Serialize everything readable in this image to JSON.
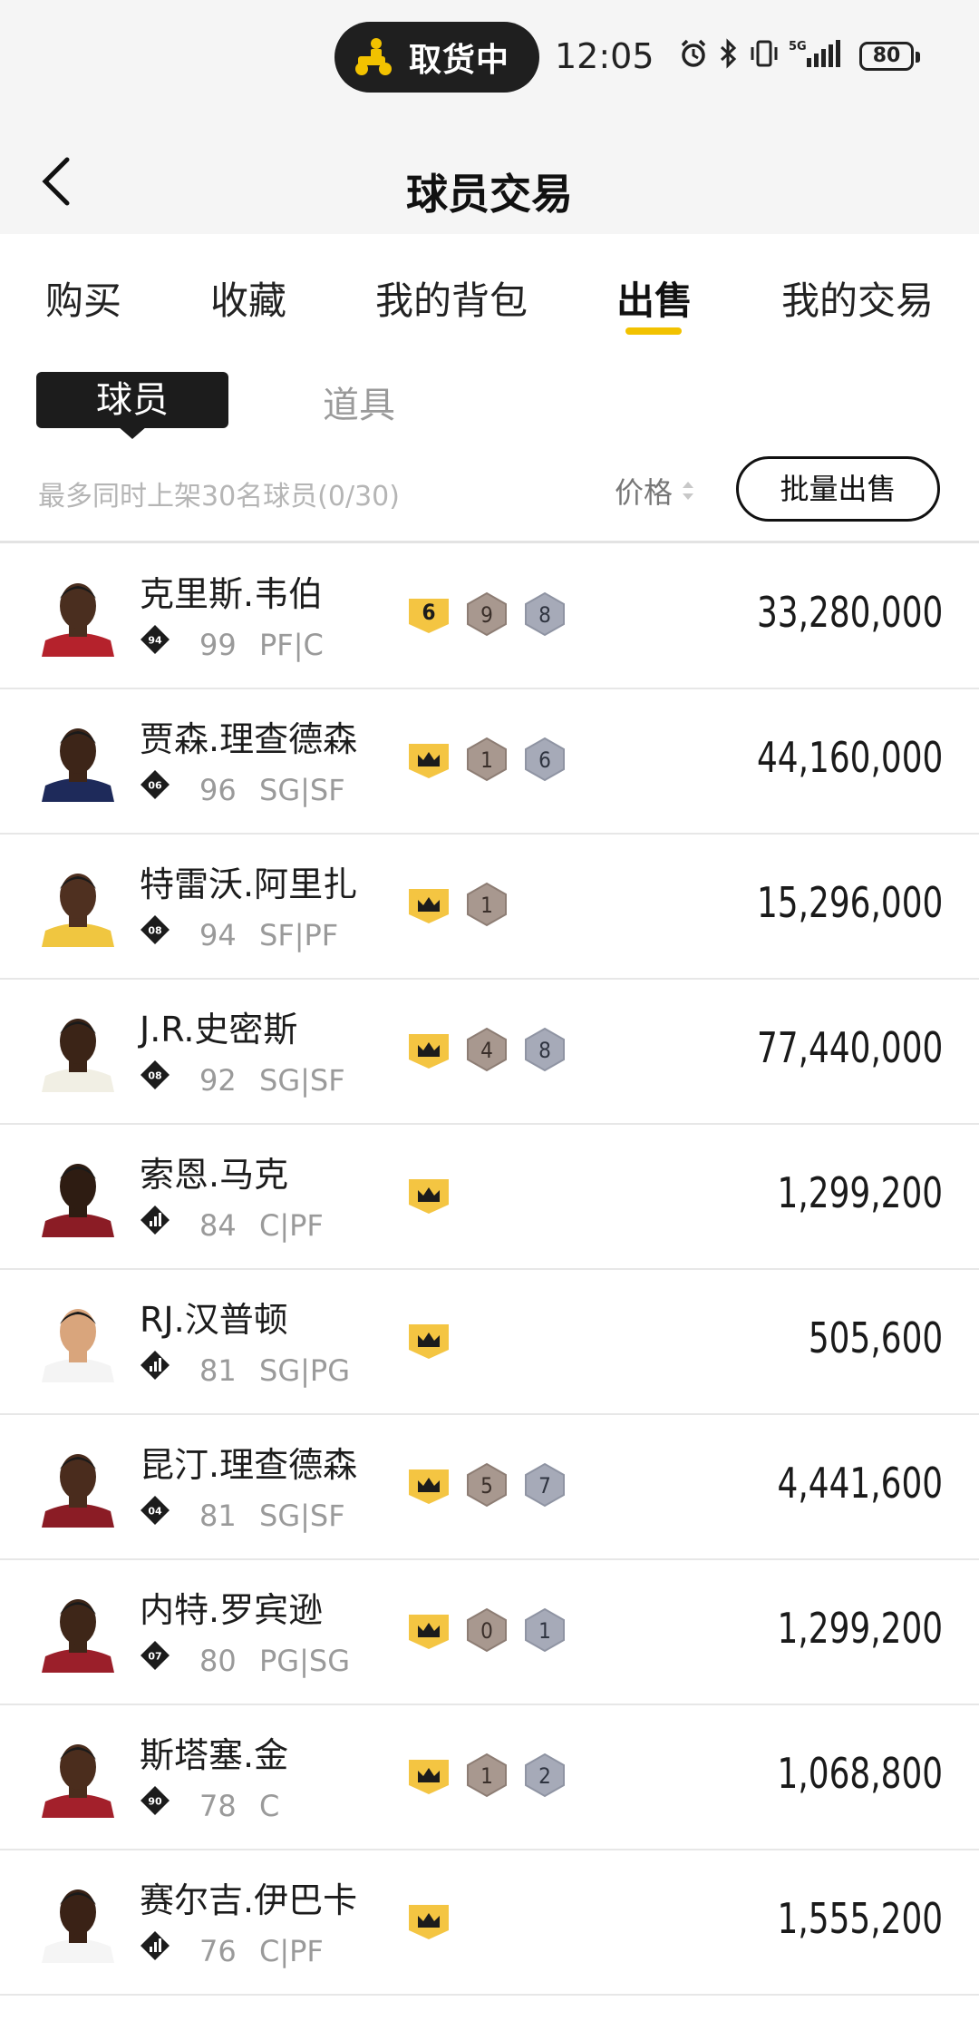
{
  "status_bar": {
    "pill_text": "取货中",
    "time": "12:05",
    "network": "5G",
    "battery": "80"
  },
  "nav": {
    "title": "球员交易"
  },
  "tabs": [
    {
      "label": "购买",
      "active": false
    },
    {
      "label": "收藏",
      "active": false
    },
    {
      "label": "我的背包",
      "active": false
    },
    {
      "label": "出售",
      "active": true
    },
    {
      "label": "我的交易",
      "active": false
    }
  ],
  "subtabs": {
    "active": "球员",
    "inactive": "道具"
  },
  "filter": {
    "hint": "最多同时上架30名球员(0/30)",
    "sort_label": "价格",
    "bulk_button": "批量出售"
  },
  "colors": {
    "accent": "#f2c200",
    "dark": "#1c1c1c",
    "gold_chip": "#f4c542",
    "bronze_chip": "#a8988f",
    "silver_chip": "#a6aab8"
  },
  "players": [
    {
      "name": "克里斯.韦伯",
      "badge": "94",
      "ovr": "99",
      "pos": "PF|C",
      "chips": [
        {
          "type": "gold",
          "text": "6"
        },
        {
          "type": "bronze",
          "text": "9"
        },
        {
          "type": "silver",
          "text": "8"
        }
      ],
      "price": "33,280,000"
    },
    {
      "name": "贾森.理查德森",
      "badge": "06",
      "ovr": "96",
      "pos": "SG|SF",
      "chips": [
        {
          "type": "crown",
          "text": ""
        },
        {
          "type": "bronze",
          "text": "1"
        },
        {
          "type": "silver",
          "text": "6"
        }
      ],
      "price": "44,160,000"
    },
    {
      "name": "特雷沃.阿里扎",
      "badge": "08",
      "ovr": "94",
      "pos": "SF|PF",
      "chips": [
        {
          "type": "crown",
          "text": ""
        },
        {
          "type": "bronze",
          "text": "1"
        }
      ],
      "price": "15,296,000"
    },
    {
      "name": "J.R.史密斯",
      "badge": "08",
      "ovr": "92",
      "pos": "SG|SF",
      "chips": [
        {
          "type": "crown",
          "text": ""
        },
        {
          "type": "bronze",
          "text": "4"
        },
        {
          "type": "silver",
          "text": "8"
        }
      ],
      "price": "77,440,000"
    },
    {
      "name": "索恩.马克",
      "badge": "bars",
      "ovr": "84",
      "pos": "C|PF",
      "chips": [
        {
          "type": "crown",
          "text": ""
        }
      ],
      "price": "1,299,200"
    },
    {
      "name": "RJ.汉普顿",
      "badge": "bars",
      "ovr": "81",
      "pos": "SG|PG",
      "chips": [
        {
          "type": "crown",
          "text": ""
        }
      ],
      "price": "505,600"
    },
    {
      "name": "昆汀.理查德森",
      "badge": "04",
      "ovr": "81",
      "pos": "SG|SF",
      "chips": [
        {
          "type": "crown",
          "text": ""
        },
        {
          "type": "bronze",
          "text": "5"
        },
        {
          "type": "silver",
          "text": "7"
        }
      ],
      "price": "4,441,600"
    },
    {
      "name": "内特.罗宾逊",
      "badge": "07",
      "ovr": "80",
      "pos": "PG|SG",
      "chips": [
        {
          "type": "crown",
          "text": ""
        },
        {
          "type": "bronze",
          "text": "0"
        },
        {
          "type": "silver",
          "text": "1"
        }
      ],
      "price": "1,299,200"
    },
    {
      "name": "斯塔塞.金",
      "badge": "90",
      "ovr": "78",
      "pos": "C",
      "chips": [
        {
          "type": "crown",
          "text": ""
        },
        {
          "type": "bronze",
          "text": "1"
        },
        {
          "type": "silver",
          "text": "2"
        }
      ],
      "price": "1,068,800"
    },
    {
      "name": "赛尔吉.伊巴卡",
      "badge": "bars",
      "ovr": "76",
      "pos": "C|PF",
      "chips": [
        {
          "type": "crown",
          "text": ""
        }
      ],
      "price": "1,555,200"
    }
  ]
}
